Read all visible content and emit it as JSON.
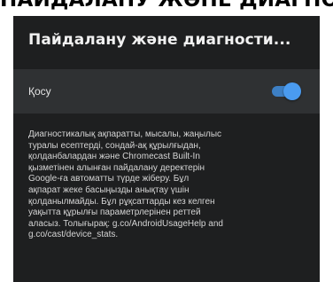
{
  "caption": "ПАЙДАЛАНУ ЖӘНЕ ДИАГНОСТИКА",
  "panel": {
    "title": "Пайдалану және диагности...",
    "toggle": {
      "label": "Қосу",
      "state": "on",
      "accent_color": "#4a9bf0"
    },
    "description": "Диагностикалық ақпаратты, мысалы, жаңылыс\nтуралы есептерді, сондай-ақ құрылғыдан,\nқолданбалардан және Chromecast Built-In\nқызметінен алынған пайдалану деректерін\nGoogle-ға автоматты түрде жіберу. Бұл\nақпарат жеке басыңызды анықтау үшін\nқолданылмайды. Бұл рұқсаттарды кез келген\nуақытта құрылғы параметрлерінен реттей\nаласыз. Толығырақ: g.co/AndroidUsageHelp and\ng.co/cast/device_stats."
  }
}
